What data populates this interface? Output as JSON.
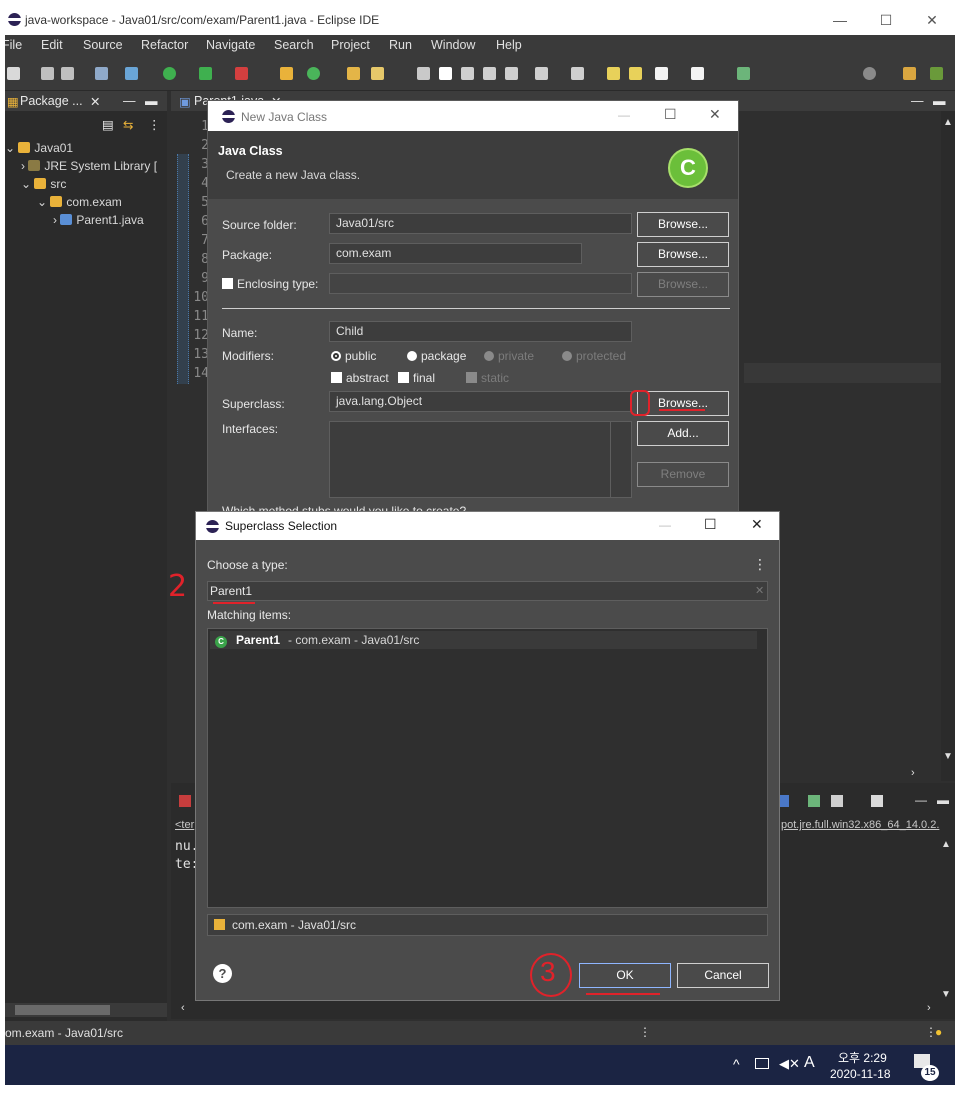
{
  "window": {
    "title": "java-workspace - Java01/src/com/exam/Parent1.java - Eclipse IDE",
    "minimize": "—",
    "maximize": "☐",
    "close": "✕"
  },
  "menu": [
    "File",
    "Edit",
    "Source",
    "Refactor",
    "Navigate",
    "Search",
    "Project",
    "Run",
    "Window",
    "Help"
  ],
  "package_explorer": {
    "tab": "Package ...",
    "tree": [
      {
        "label": "Java01"
      },
      {
        "label": "JRE System Library ["
      },
      {
        "label": "src"
      },
      {
        "label": "com.exam"
      },
      {
        "label": "Parent1.java"
      }
    ]
  },
  "editor": {
    "tab": "Parent1.java",
    "line_numbers": [
      "1",
      "2",
      "3",
      "4",
      "5",
      "6",
      "7",
      "8",
      "9",
      "10",
      "11",
      "12",
      "13",
      "14"
    ]
  },
  "console": {
    "header": "<ter",
    "lines": [
      "nu.",
      "te:"
    ],
    "path_text": "pot.jre.full.win32.x86_64_14.0.2."
  },
  "status": {
    "text": "om.exam - Java01/src"
  },
  "taskbar": {
    "ime": "A",
    "ampm_time": "오후 2:29",
    "date": "2020-11-18",
    "notifications": "15"
  },
  "new_java_class": {
    "title": "New Java Class",
    "header_title": "Java Class",
    "header_subtitle": "Create a new Java class.",
    "source_folder_label": "Source folder:",
    "source_folder_value": "Java01/src",
    "package_label": "Package:",
    "package_value": "com.exam",
    "enclosing_label": "Enclosing type:",
    "name_label": "Name:",
    "name_value": "Child",
    "modifiers_label": "Modifiers:",
    "mod_public": "public",
    "mod_package": "package",
    "mod_private": "private",
    "mod_protected": "protected",
    "mod_abstract": "abstract",
    "mod_final": "final",
    "mod_static": "static",
    "superclass_label": "Superclass:",
    "superclass_value": "java.lang.Object",
    "interfaces_label": "Interfaces:",
    "browse": "Browse...",
    "add": "Add...",
    "remove": "Remove",
    "stubs_text": "Which method stubs would you like to create?"
  },
  "superclass_selection": {
    "title": "Superclass Selection",
    "choose_label": "Choose a type:",
    "filter_value": "Parent1",
    "matching_label": "Matching items:",
    "match_name": "Parent1",
    "match_detail": " - com.exam - Java01/src",
    "footer_path": "com.exam - Java01/src",
    "ok": "OK",
    "cancel": "Cancel",
    "help": "?"
  },
  "annotations": {
    "step2": "2",
    "step3": "3"
  },
  "colors": {
    "accent": "#e0222a",
    "dark_bg": "#2b2b2b",
    "dialog_bg": "#4b4b4b"
  }
}
